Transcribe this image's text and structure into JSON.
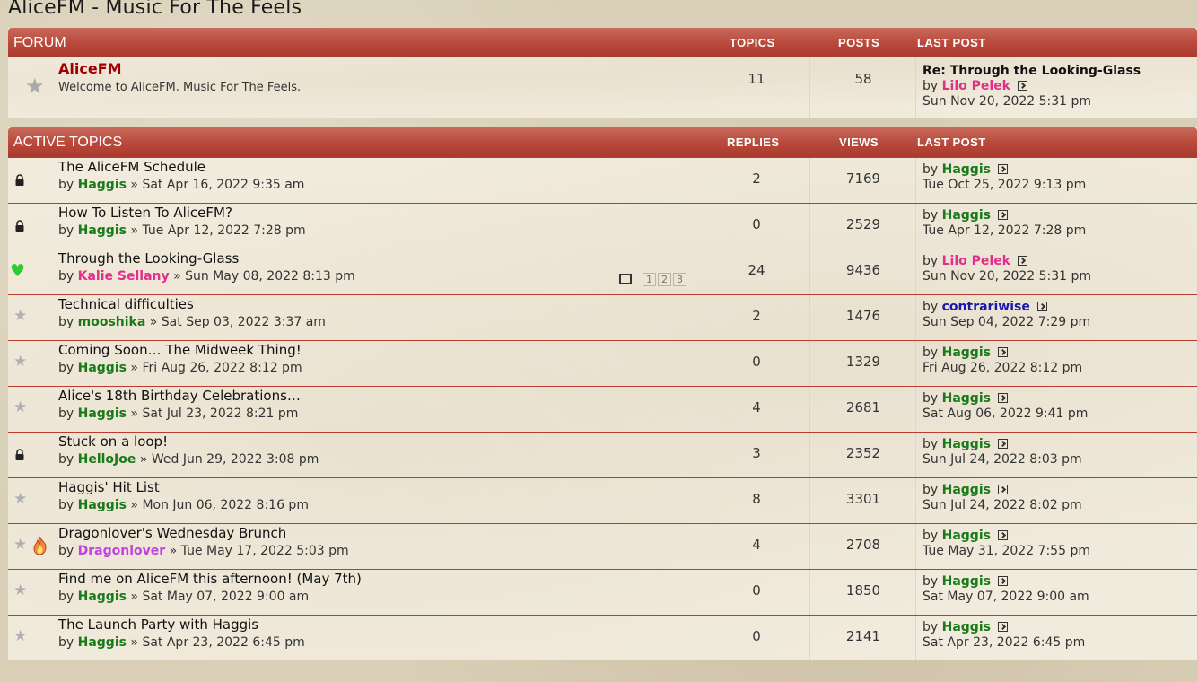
{
  "site_title": "AliceFM - Music For The Feels",
  "forum_section": {
    "header": {
      "title": "FORUM",
      "col_topics": "TOPICS",
      "col_posts": "POSTS",
      "col_last_post": "LAST POST"
    },
    "forum": {
      "name": "AliceFM",
      "description": "Welcome to AliceFM. Music For The Feels.",
      "topics": "11",
      "posts": "58",
      "last_post_title": "Re: Through the Looking-Glass",
      "last_post_by_prefix": "by",
      "last_post_author": "Lilo Pelek",
      "last_post_time": "Sun Nov 20, 2022 5:31 pm"
    }
  },
  "topics_section": {
    "header": {
      "title": "ACTIVE TOPICS",
      "col_replies": "REPLIES",
      "col_views": "VIEWS",
      "col_last_post": "LAST POST"
    },
    "by_prefix": "by",
    "sep": "»",
    "topics": [
      {
        "icon": "lock-icon",
        "title": "The AliceFM Schedule",
        "author": "Haggis",
        "author_color": "#1a7a1a",
        "date": "Sat Apr 16, 2022 9:35 am",
        "replies": "2",
        "views": "7169",
        "last_author": "Haggis",
        "last_author_color": "#1a7a1a",
        "last_time": "Tue Oct 25, 2022 9:13 pm"
      },
      {
        "icon": "lock-icon",
        "title": "How To Listen To AliceFM?",
        "author": "Haggis",
        "author_color": "#1a7a1a",
        "date": "Tue Apr 12, 2022 7:28 pm",
        "replies": "0",
        "views": "2529",
        "last_author": "Haggis",
        "last_author_color": "#1a7a1a",
        "last_time": "Tue Apr 12, 2022 7:28 pm"
      },
      {
        "icon": "heart-icon",
        "title": "Through the Looking-Glass",
        "author": "Kalie Sellany",
        "author_color": "#e0308a",
        "date": "Sun May 08, 2022 8:13 pm",
        "replies": "24",
        "views": "9436",
        "last_author": "Lilo Pelek",
        "last_author_color": "#e0308a",
        "last_time": "Sun Nov 20, 2022 5:31 pm",
        "pages": [
          "1",
          "2",
          "3"
        ]
      },
      {
        "icon": "star-icon",
        "title": "Technical difficulties",
        "author": "mooshika",
        "author_color": "#1a7a1a",
        "date": "Sat Sep 03, 2022 3:37 am",
        "replies": "2",
        "views": "1476",
        "last_author": "contrariwise",
        "last_author_color": "#1a1aaa",
        "last_time": "Sun Sep 04, 2022 7:29 pm"
      },
      {
        "icon": "star-icon",
        "title": "Coming Soon… The Midweek Thing!",
        "author": "Haggis",
        "author_color": "#1a7a1a",
        "date": "Fri Aug 26, 2022 8:12 pm",
        "replies": "0",
        "views": "1329",
        "last_author": "Haggis",
        "last_author_color": "#1a7a1a",
        "last_time": "Fri Aug 26, 2022 8:12 pm"
      },
      {
        "icon": "star-icon",
        "title": "Alice's 18th Birthday Celebrations…",
        "author": "Haggis",
        "author_color": "#1a7a1a",
        "date": "Sat Jul 23, 2022 8:21 pm",
        "replies": "4",
        "views": "2681",
        "last_author": "Haggis",
        "last_author_color": "#1a7a1a",
        "last_time": "Sat Aug 06, 2022 9:41 pm"
      },
      {
        "icon": "lock-icon",
        "title": "Stuck on a loop!",
        "author": "HelloJoe",
        "author_color": "#1a7a1a",
        "date": "Wed Jun 29, 2022 3:08 pm",
        "replies": "3",
        "views": "2352",
        "last_author": "Haggis",
        "last_author_color": "#1a7a1a",
        "last_time": "Sun Jul 24, 2022 8:03 pm"
      },
      {
        "icon": "star-icon",
        "title": "Haggis' Hit List",
        "author": "Haggis",
        "author_color": "#1a7a1a",
        "date": "Mon Jun 06, 2022 8:16 pm",
        "replies": "8",
        "views": "3301",
        "last_author": "Haggis",
        "last_author_color": "#1a7a1a",
        "last_time": "Sun Jul 24, 2022 8:02 pm"
      },
      {
        "icon": "star-icon",
        "extra_icon": "flame-icon",
        "title": "Dragonlover's Wednesday Brunch",
        "author": "Dragonlover",
        "author_color": "#c040e0",
        "date": "Tue May 17, 2022 5:03 pm",
        "replies": "4",
        "views": "2708",
        "last_author": "Haggis",
        "last_author_color": "#1a7a1a",
        "last_time": "Tue May 31, 2022 7:55 pm"
      },
      {
        "icon": "star-icon",
        "title": "Find me on AliceFM this afternoon! (May 7th)",
        "author": "Haggis",
        "author_color": "#1a7a1a",
        "date": "Sat May 07, 2022 9:00 am",
        "replies": "0",
        "views": "1850",
        "last_author": "Haggis",
        "last_author_color": "#1a7a1a",
        "last_time": "Sat May 07, 2022 9:00 am"
      },
      {
        "icon": "star-icon",
        "title": "The Launch Party with Haggis",
        "author": "Haggis",
        "author_color": "#1a7a1a",
        "date": "Sat Apr 23, 2022 6:45 pm",
        "replies": "0",
        "views": "2141",
        "last_author": "Haggis",
        "last_author_color": "#1a7a1a",
        "last_time": "Sat Apr 23, 2022 6:45 pm"
      }
    ]
  },
  "colors": {
    "header": "#b94a3c",
    "forum_link": "#a00000",
    "row_border": "#b93e2f"
  }
}
